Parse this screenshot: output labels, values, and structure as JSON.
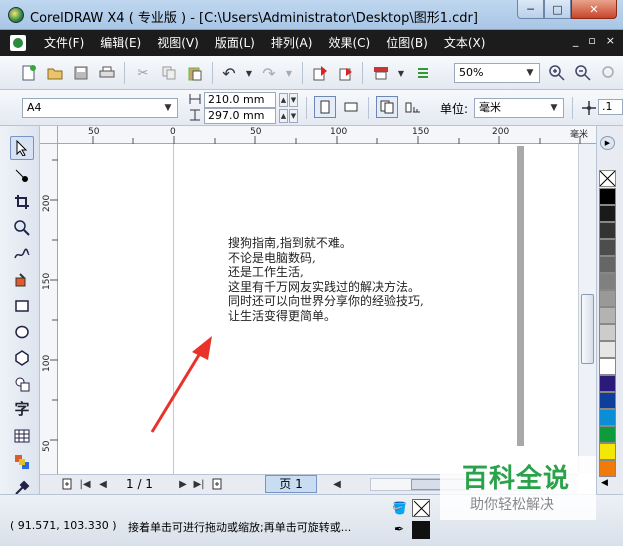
{
  "window": {
    "title": "CorelDRAW X4 ( 专业版 ) - [C:\\Users\\Administrator\\Desktop\\图形1.cdr]",
    "minimize": "─",
    "maximize": "□",
    "close": "✕"
  },
  "menu": {
    "items": [
      "文件(F)",
      "编辑(E)",
      "视图(V)",
      "版面(L)",
      "排列(A)",
      "效果(C)",
      "位图(B)",
      "文本(X)"
    ],
    "right_controls": [
      "_",
      "▫",
      "×"
    ]
  },
  "toolbar1": {
    "zoom_value": "50%"
  },
  "toolbar2": {
    "page_size": "A4",
    "width_value": "210.0 mm",
    "height_value": "297.0 mm",
    "unit_label": "单位:",
    "unit_value": "毫米",
    "nudge_value": ".1"
  },
  "rulers": {
    "h_labels": [
      "50",
      "0",
      "50",
      "100",
      "150",
      "200"
    ],
    "v_labels": [
      "200",
      "150",
      "100",
      "50"
    ],
    "unit_label": "毫米"
  },
  "document": {
    "lines": [
      "搜狗指南,指到就不难。",
      "不论是电脑数码,",
      "还是工作生活,",
      "这里有千万网友实践过的解决方法。",
      "同时还可以向世界分享你的经验技巧,",
      "让生活变得更简单。"
    ]
  },
  "navigation": {
    "page_counter": "1 / 1",
    "page_tab": "页 1"
  },
  "status": {
    "coords": "( 91.571, 103.330 )",
    "hint": "接着单击可进行拖动或缩放;再单击可旋转或..."
  },
  "palette": {
    "colors": [
      "#000000",
      "#1a1a1a",
      "#333333",
      "#4d4d4d",
      "#666666",
      "#808080",
      "#999999",
      "#b3b3b3",
      "#cccccc",
      "#e6e6e6",
      "#ffffff",
      "#2b1a7a",
      "#0f3f9a",
      "#0a8fd4",
      "#0f9a3c",
      "#f5e60a",
      "#f07a0a"
    ]
  },
  "watermark": {
    "title": "百科全说",
    "subtitle": "助你轻松解决"
  }
}
